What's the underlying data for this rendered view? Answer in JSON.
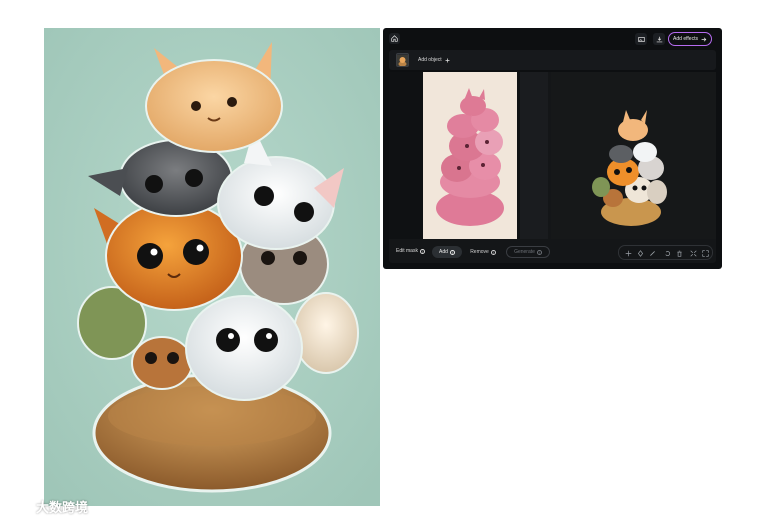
{
  "colors": {
    "app_bg": "#0d0f11",
    "accent_border": "#b66cf0",
    "mint_bg": "#a9cfc2",
    "pink_subject": "#df7a97"
  },
  "topbar": {
    "home_icon": "home-icon",
    "image_icon": "image-icon",
    "download_icon": "download-icon",
    "effects_label": "Add effects",
    "effects_icon": "arrow-right-icon"
  },
  "objectbar": {
    "add_object_label": "Add object",
    "add_icon": "plus-icon"
  },
  "maskbar": {
    "edit_mask_label": "Edit mask",
    "add_label": "Add",
    "remove_label": "Remove",
    "generate_label": "Generate"
  },
  "tools": [
    "move-icon",
    "mask-icon",
    "brush-icon",
    "undo-icon",
    "delete-icon",
    "fit-icon",
    "fullscreen-icon"
  ],
  "watermark": {
    "text": "大数跨境",
    "logo": "brand-logo-icon"
  }
}
